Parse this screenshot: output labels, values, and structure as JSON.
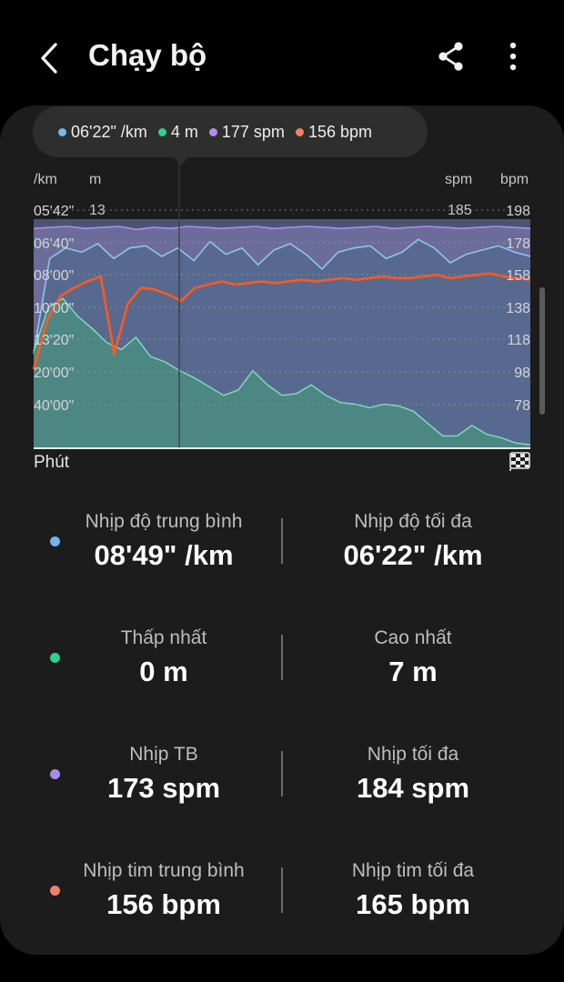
{
  "header": {
    "title": "Chạy bộ",
    "back_icon": "chevron-left-icon",
    "share_icon": "share-icon",
    "more_icon": "more-vertical-icon"
  },
  "tooltip": {
    "items": [
      {
        "label": "06'22\" /km",
        "color": "#7ab8ec"
      },
      {
        "label": "4 m",
        "color": "#2fd08a"
      },
      {
        "label": "177 spm",
        "color": "#b28cee"
      },
      {
        "label": "156 bpm",
        "color": "#f0806a"
      }
    ]
  },
  "chart_data": {
    "type": "line",
    "xlabel": "Phút",
    "axes": {
      "pace": {
        "unit": "/km",
        "ticks": [
          "05'42\"",
          "06'40\"",
          "08'00\"",
          "10'00\"",
          "13'20\"",
          "20'00\"",
          "40'00\""
        ]
      },
      "elevation": {
        "unit": "m",
        "max": 13
      },
      "cadence": {
        "unit": "spm",
        "max": 185
      },
      "heart_rate": {
        "unit": "bpm",
        "ticks": [
          "198",
          "178",
          "158",
          "138",
          "118",
          "98",
          "78"
        ]
      }
    },
    "series": [
      {
        "name": "06'22\" /km",
        "unit": "/km",
        "color": "#8ec4ee",
        "values": [
          13.0,
          8.5,
          8.0,
          8.2,
          7.8,
          8.5,
          8.0,
          7.9,
          8.4,
          8.0,
          8.6,
          7.7,
          8.3,
          8.0,
          8.8,
          8.1,
          7.8,
          8.3,
          9.0,
          8.2,
          8.0,
          7.9,
          8.5,
          8.2,
          7.6,
          8.0,
          8.7,
          8.3,
          8.1,
          7.9,
          8.2,
          8.4
        ]
      },
      {
        "name": "4 m",
        "unit": "m",
        "color": "#2fd08a",
        "values": [
          5.5,
          8.0,
          8.5,
          7.5,
          6.8,
          6.0,
          5.6,
          6.3,
          5.2,
          4.9,
          4.4,
          4.0,
          3.5,
          3.0,
          3.3,
          4.4,
          3.6,
          3.0,
          3.1,
          3.6,
          3.0,
          2.6,
          2.5,
          2.3,
          2.5,
          2.4,
          2.1,
          1.4,
          0.7,
          0.7,
          1.3,
          0.8,
          0.6,
          0.3,
          0.2
        ]
      },
      {
        "name": "177 spm",
        "unit": "spm",
        "color": "#b28cee",
        "values": [
          176,
          177,
          178,
          176,
          177,
          178,
          175,
          177,
          176,
          178,
          177,
          176,
          177,
          178,
          176,
          177,
          178,
          177,
          176,
          177,
          178,
          176,
          177,
          178,
          177,
          176,
          177,
          178,
          177,
          176
        ]
      },
      {
        "name": "156 bpm",
        "unit": "bpm",
        "color": "#ff5a1f",
        "values": [
          100,
          130,
          145,
          150,
          154,
          157,
          109,
          140,
          150,
          149,
          146,
          142,
          150,
          152,
          154,
          152,
          153,
          154,
          153,
          154,
          155,
          154,
          155,
          156,
          155,
          156,
          157,
          156,
          156,
          157,
          158,
          156,
          157,
          158,
          159,
          157,
          156,
          155
        ]
      }
    ]
  },
  "stats": [
    {
      "dot_color": "#6fb3f2",
      "left_label": "Nhịp độ trung bình",
      "left_value": "08'49\" /km",
      "right_label": "Nhịp độ tối đa",
      "right_value": "06'22\" /km"
    },
    {
      "dot_color": "#2fd08a",
      "left_label": "Thấp nhất",
      "left_value": "0 m",
      "right_label": "Cao nhất",
      "right_value": "7 m"
    },
    {
      "dot_color": "#a98be8",
      "left_label": "Nhịp TB",
      "left_value": "173 spm",
      "right_label": "Nhịp tối đa",
      "right_value": "184 spm"
    },
    {
      "dot_color": "#f0806a",
      "left_label": "Nhịp tim trung bình",
      "left_value": "156 bpm",
      "right_label": "Nhịp tim tối đa",
      "right_value": "165 bpm"
    }
  ]
}
